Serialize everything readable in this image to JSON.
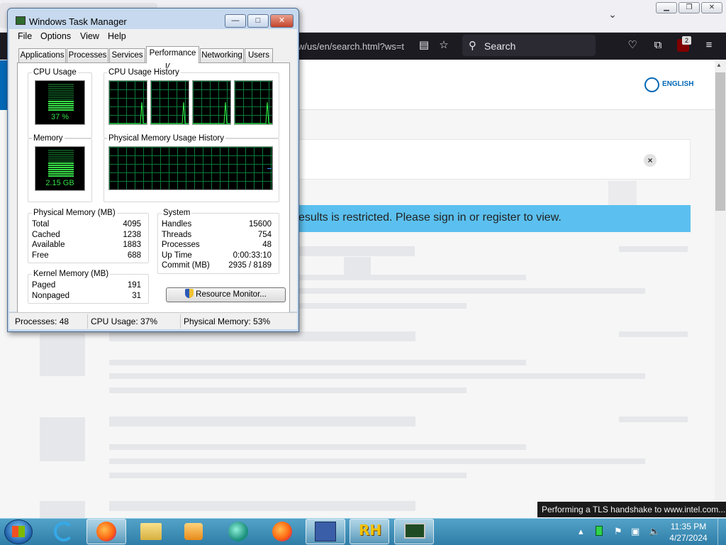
{
  "browser": {
    "url_fragment": "w/us/en/search.html?ws=t",
    "search_placeholder": "Search",
    "notification_count": "2",
    "language_label": "ENGLISH",
    "restricted_message": "esults is restricted. Please sign in or register to view.",
    "dismiss_glyph": "×"
  },
  "taskmanager": {
    "title": "Windows Task Manager",
    "window_buttons": {
      "minimize": "—",
      "maximize": "□",
      "close": "✕"
    },
    "menu": [
      "File",
      "Options",
      "View",
      "Help"
    ],
    "tabs": [
      "Applications",
      "Processes",
      "Services",
      "Performance",
      "Networking",
      "Users"
    ],
    "active_tab": "Performance",
    "labels": {
      "cpu_usage": "CPU Usage",
      "cpu_history": "CPU Usage History",
      "memory": "Memory",
      "mem_history": "Physical Memory Usage History"
    },
    "cpu_value": "37 %",
    "cpu_percent": 37,
    "memory_value": "2.15 GB",
    "memory_percent": 53,
    "physical_memory": {
      "title": "Physical Memory (MB)",
      "rows": [
        {
          "label": "Total",
          "value": "4095"
        },
        {
          "label": "Cached",
          "value": "1238"
        },
        {
          "label": "Available",
          "value": "1883"
        },
        {
          "label": "Free",
          "value": "688"
        }
      ]
    },
    "kernel_memory": {
      "title": "Kernel Memory (MB)",
      "rows": [
        {
          "label": "Paged",
          "value": "191"
        },
        {
          "label": "Nonpaged",
          "value": "31"
        }
      ]
    },
    "system": {
      "title": "System",
      "rows": [
        {
          "label": "Handles",
          "value": "15600"
        },
        {
          "label": "Threads",
          "value": "754"
        },
        {
          "label": "Processes",
          "value": "48"
        },
        {
          "label": "Up Time",
          "value": "0:00:33:10"
        },
        {
          "label": "Commit (MB)",
          "value": "2935 / 8189"
        }
      ]
    },
    "resource_monitor_button": "Resource Monitor...",
    "status": {
      "processes": "Processes: 48",
      "cpu": "CPU Usage: 37%",
      "memory": "Physical Memory: 53%"
    }
  },
  "tooltip": "Performing a TLS handshake to www.intel.com...",
  "taskbar": {
    "time": "11:35 PM",
    "date": "4/27/2024",
    "rh_label": "RH"
  }
}
